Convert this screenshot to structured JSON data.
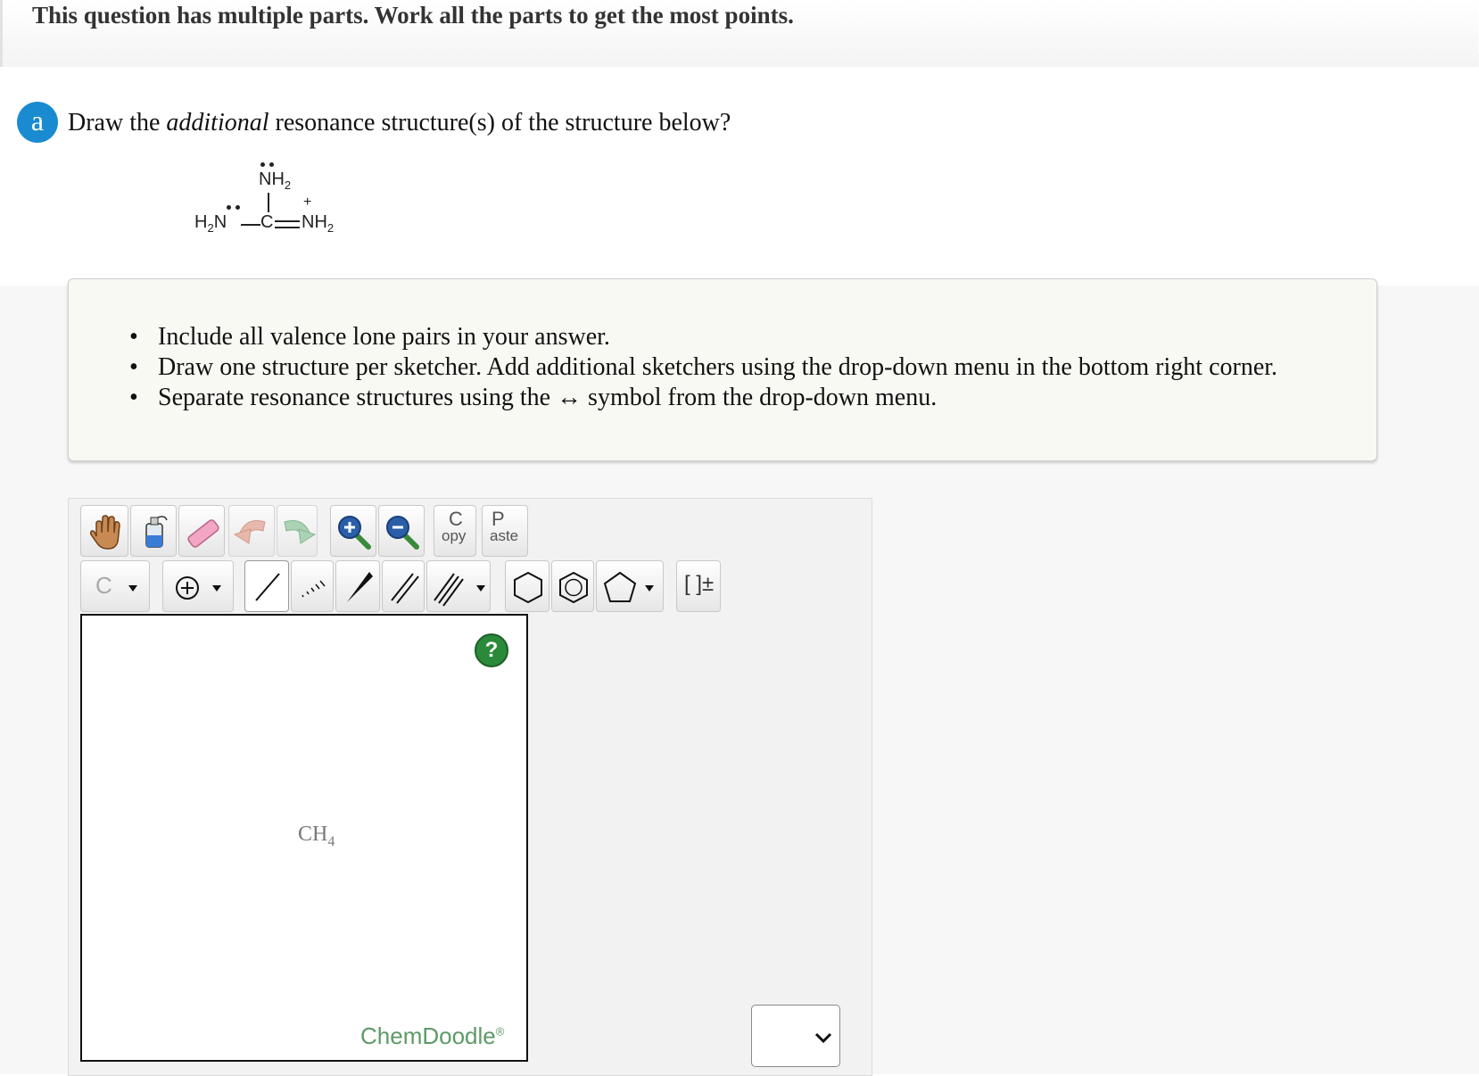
{
  "header": {
    "title": "This question has multiple parts. Work all the parts to get the most points."
  },
  "part": {
    "badge": "a",
    "question_prefix": "Draw the ",
    "question_emphasis": "additional",
    "question_suffix": " resonance structure(s) of the structure below?"
  },
  "molecule": {
    "top_group": "NH",
    "top_sub": "2",
    "left_h": "H",
    "left_sub": "2",
    "left_n": "N",
    "center": "C",
    "right_group": "NH",
    "right_sub": "2",
    "charge": "+"
  },
  "instructions": [
    "Include all valence lone pairs in your answer.",
    "Draw one structure per sketcher. Add additional sketchers using the drop-down menu in the bottom right corner.",
    "Separate resonance structures using the ↔ symbol from the drop-down menu."
  ],
  "bullet": "•",
  "toolbar": {
    "copy_top": "C",
    "copy_bottom": "opy",
    "paste_top": "P",
    "paste_bottom": "aste",
    "element": "C",
    "bracket": "[ ]±"
  },
  "canvas": {
    "help": "?",
    "default_molecule": "CH",
    "default_molecule_sub": "4",
    "brand": "ChemDoodle",
    "brand_mark": "®"
  },
  "select": {
    "value": ""
  },
  "colors": {
    "accent": "#1a8bd1",
    "help": "#2a8a3a",
    "brand": "#5d9a66"
  }
}
